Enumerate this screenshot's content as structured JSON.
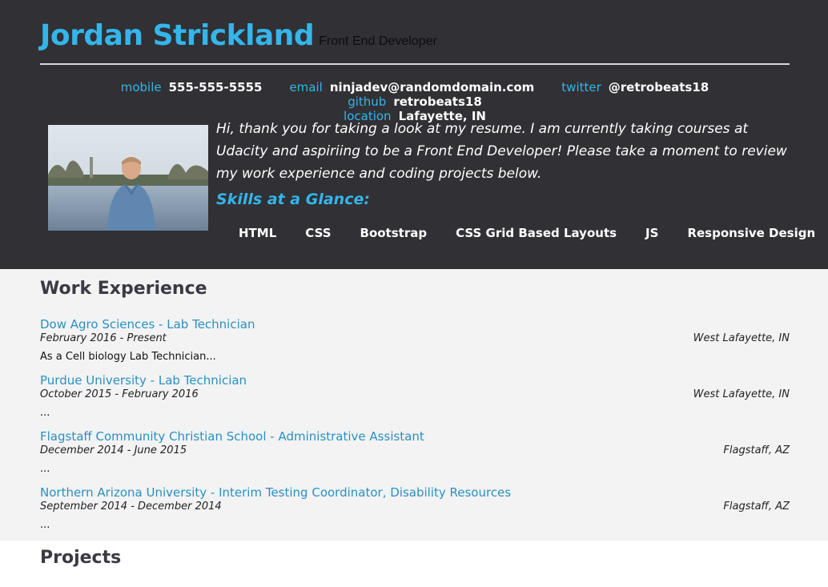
{
  "header": {
    "name": "Jordan Strickland",
    "role": "Front End Developer",
    "contacts": [
      {
        "label": "mobile",
        "value": "555-555-5555"
      },
      {
        "label": "email",
        "value": "ninjadev@randomdomain.com"
      },
      {
        "label": "twitter",
        "value": "@retrobeats18"
      },
      {
        "label": "github",
        "value": "retrobeats18"
      },
      {
        "label": "location",
        "value": "Lafayette, IN"
      }
    ],
    "welcome_message": "Hi, thank you for taking a look at my resume. I am currently taking courses at Udacity and aspiriing to be a Front End Developer! Please take a moment to review my work experience and coding projects below.",
    "skills_heading": "Skills at a Glance:",
    "skills": [
      "HTML",
      "CSS",
      "Bootstrap",
      "CSS Grid Based Layouts",
      "JS",
      "Responsive Design"
    ]
  },
  "work": {
    "title": "Work Experience",
    "jobs": [
      {
        "title": "Dow Agro Sciences - Lab Technician",
        "dates": "February 2016 - Present",
        "location": "West Lafayette, IN",
        "description": "As a Cell biology Lab Technician..."
      },
      {
        "title": "Purdue University - Lab Technician",
        "dates": "October 2015 - February 2016",
        "location": "West Lafayette, IN",
        "description": "..."
      },
      {
        "title": "Flagstaff Community Christian School - Administrative Assistant",
        "dates": "December 2014 - June 2015",
        "location": "Flagstaff, AZ",
        "description": "..."
      },
      {
        "title": "Northern Arizona University - Interim Testing Coordinator, Disability Resources",
        "dates": "September 2014 - December 2014",
        "location": "Flagstaff, AZ",
        "description": "..."
      }
    ]
  },
  "projects": {
    "title": "Projects"
  },
  "colors": {
    "header_bg": "#303035",
    "accent": "#35b5e9",
    "link": "#2a90c2",
    "work_bg": "#f3f3f3"
  },
  "icons": {
    "profile_photo": "profile-photo"
  }
}
